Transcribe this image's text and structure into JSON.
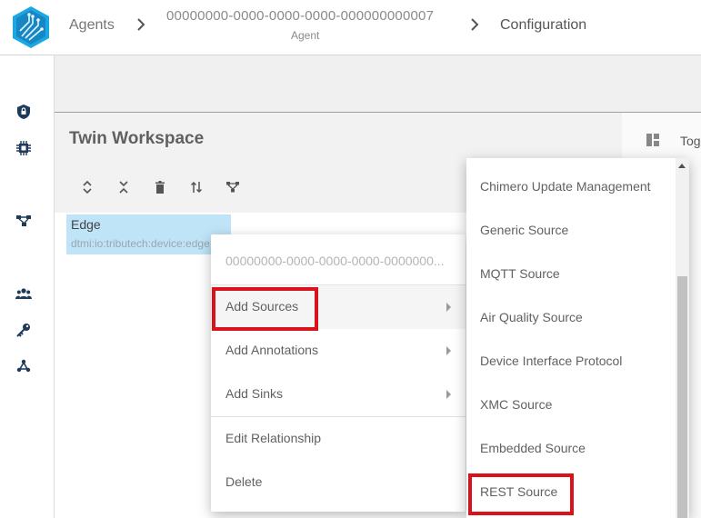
{
  "breadcrumb": {
    "agents": "Agents",
    "agent_id": "00000000-0000-0000-0000-000000000007",
    "agent_sub": "Agent",
    "configuration": "Configuration"
  },
  "sidebar": {
    "icons": [
      "shield-lock-icon",
      "chip-icon",
      "hierarchy-icon",
      "users-icon",
      "key-icon",
      "webhook-icon"
    ]
  },
  "workspace": {
    "title": "Twin Workspace",
    "toolbar": [
      "expand-icon",
      "collapse-icon",
      "delete-icon",
      "sort-icon",
      "hierarchy-icon"
    ]
  },
  "right_panel": {
    "toggle_label": "Tog"
  },
  "node": {
    "title": "Edge",
    "subtitle": "dtmi:io:tributech:device:edge"
  },
  "context_menu": {
    "header": "00000000-0000-0000-0000-0000000...",
    "items": [
      {
        "label": "Add Sources"
      },
      {
        "label": "Add Annotations"
      },
      {
        "label": "Add Sinks"
      },
      {
        "label": "Edit Relationship"
      },
      {
        "label": "Delete"
      }
    ]
  },
  "submenu": {
    "items": [
      {
        "label": "Chimero Update Management"
      },
      {
        "label": "Generic Source"
      },
      {
        "label": "MQTT Source"
      },
      {
        "label": "Air Quality Source"
      },
      {
        "label": "Device Interface Protocol"
      },
      {
        "label": "XMC Source"
      },
      {
        "label": "Embedded Source"
      },
      {
        "label": "REST Source"
      }
    ]
  },
  "colors": {
    "highlight": "#d9121b",
    "node_bg": "#bfe3f7",
    "logo_accent": "#1ba7e0"
  }
}
